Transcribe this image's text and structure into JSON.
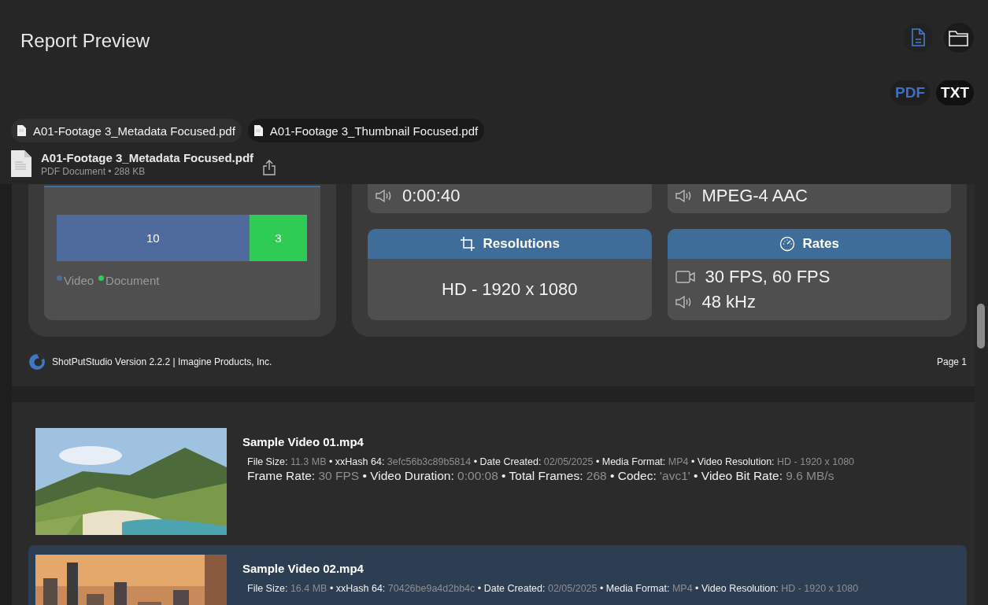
{
  "window": {
    "title": "Report Preview"
  },
  "view_buttons": [
    {
      "kind": "document",
      "selected": true
    },
    {
      "kind": "folder",
      "selected": false
    }
  ],
  "format_toggle": [
    {
      "label": "PDF",
      "selected": true
    },
    {
      "label": "TXT",
      "selected": false
    }
  ],
  "file_tabs": [
    {
      "label": "A01-Footage 3_Metadata Focused.pdf",
      "selected": true
    },
    {
      "label": "A01-Footage 3_Thumbnail Focused.pdf",
      "selected": false
    }
  ],
  "file_info": {
    "name": "A01-Footage 3_Metadata Focused.pdf",
    "details": "PDF Document • 288 KB"
  },
  "report": {
    "summary": {
      "chart_data": {
        "type": "bar",
        "orientation": "horizontal",
        "stacked": true,
        "data_labels": true,
        "legend": "bottom",
        "series": [
          {
            "name": "Video",
            "color": "#4f6a9c",
            "values": [
              10
            ]
          },
          {
            "name": "Document",
            "color": "#2ecc55",
            "values": [
              3
            ]
          }
        ]
      }
    },
    "info_cards": [
      {
        "kind": "value",
        "lines": [
          {
            "kind": "audio",
            "text": "0:00:40"
          }
        ]
      },
      {
        "kind": "value",
        "lines": [
          {
            "kind": "audio",
            "text": "MPEG-4 AAC"
          }
        ]
      },
      {
        "kind": "resolution",
        "title": "Resolutions",
        "lines": [
          {
            "kind": "plain",
            "text": "HD - 1920 x 1080"
          }
        ]
      },
      {
        "kind": "rates",
        "title": "Rates",
        "lines": [
          {
            "kind": "video",
            "text": "30 FPS, 60 FPS"
          },
          {
            "kind": "audio",
            "text": "48 kHz"
          }
        ]
      }
    ],
    "footer": {
      "credit": "ShotPutStudio Version 2.2.2 | Imagine Products, Inc.",
      "page": "Page 1"
    }
  },
  "clips": {
    "separator": "•",
    "items": [
      {
        "name": "Sample Video 01.mp4",
        "selected": false,
        "meta": [
          [
            {
              "label": "File Size:",
              "value": "11.3 MB"
            },
            {
              "label": "xxHash 64:",
              "value": "3efc56b3c89b5814"
            },
            {
              "label": "Date Created:",
              "value": "02/05/2025"
            },
            {
              "label": "Media Format:",
              "value": "MP4"
            },
            {
              "label": "Video Resolution:",
              "value": "HD - 1920 x 1080"
            }
          ],
          [
            {
              "label": "Frame Rate:",
              "value": "30 FPS"
            },
            {
              "label": "Video Duration:",
              "value": "0:00:08"
            },
            {
              "label": "Total Frames:",
              "value": "268"
            },
            {
              "label": "Codec:",
              "value": "'avc1'"
            },
            {
              "label": "Video Bit Rate:",
              "value": "9.6 MB/s"
            }
          ]
        ]
      },
      {
        "name": "Sample Video 02.mp4",
        "selected": true,
        "meta": [
          [
            {
              "label": "File Size:",
              "value": "16.4 MB"
            },
            {
              "label": "xxHash 64:",
              "value": "70426be9a4d2bb4c"
            },
            {
              "label": "Date Created:",
              "value": "02/05/2025"
            },
            {
              "label": "Media Format:",
              "value": "MP4"
            },
            {
              "label": "Video Resolution:",
              "value": "HD - 1920 x 1080"
            }
          ]
        ]
      }
    ]
  }
}
